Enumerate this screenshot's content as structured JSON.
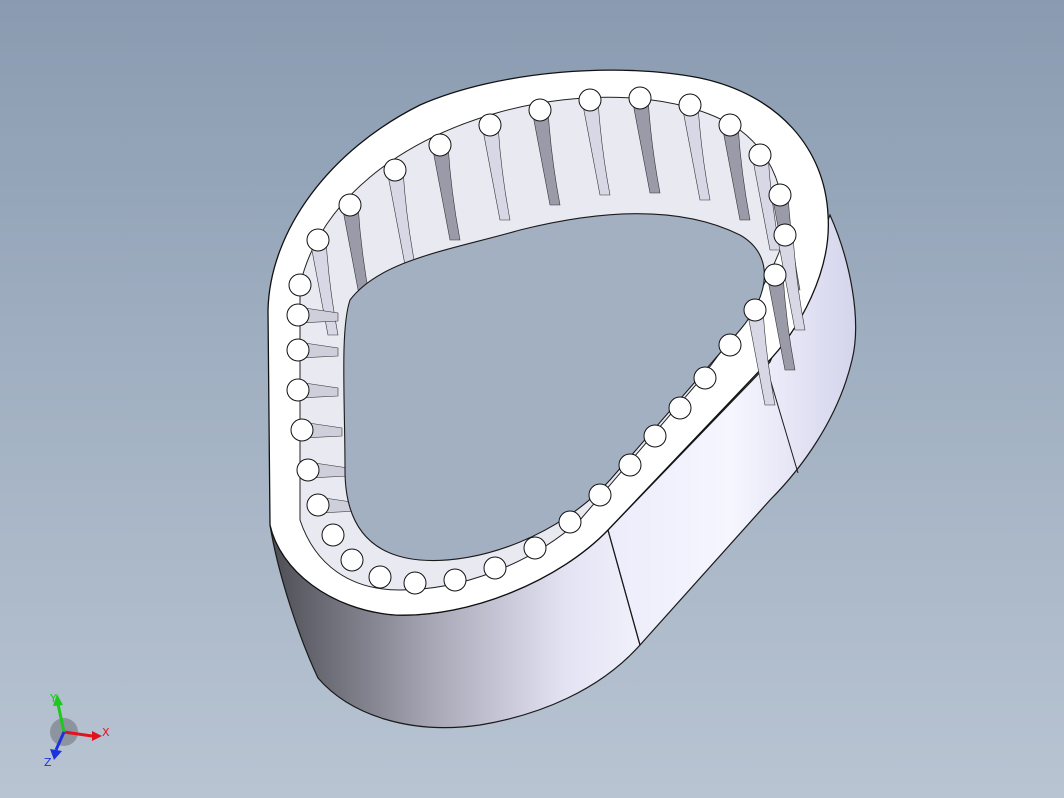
{
  "viewport": {
    "background_top": "#8a9bb1",
    "background_bottom": "#b8c4d2"
  },
  "model": {
    "part": "timing-belt",
    "face_color": "#ffffff",
    "tooth_count": 36,
    "edge_color": "#111111",
    "outer_shade_dark": "#4d4d55",
    "outer_shade_light": "#eaeaf8"
  },
  "triad": {
    "x_label": "X",
    "y_label": "Y",
    "z_label": "Z",
    "x_color": "#e0141e",
    "y_color": "#1ec81e",
    "z_color": "#1e32dc"
  }
}
